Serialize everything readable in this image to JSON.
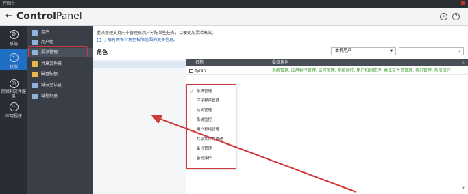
{
  "window": {
    "title": "控制台"
  },
  "header": {
    "logo_part1": "Control",
    "logo_part2": "Panel",
    "icons": [
      "search-icon",
      "help-icon"
    ]
  },
  "rail": {
    "items": [
      {
        "label": "系统",
        "icon": "gear-icon"
      },
      {
        "label": "权限",
        "icon": "user-icon"
      },
      {
        "label": "网络和文件服务",
        "icon": "globe-icon"
      },
      {
        "label": "应用程序",
        "icon": "apps-icon"
      }
    ]
  },
  "subnav": {
    "items": [
      {
        "label": "用户"
      },
      {
        "label": "用户组"
      },
      {
        "label": "委派管理"
      },
      {
        "label": "共享文件夹"
      },
      {
        "label": "磁盘配额"
      },
      {
        "label": "域安全认证"
      },
      {
        "label": "域控制器"
      }
    ]
  },
  "content": {
    "description": "委派管理支持向非管理员用户分配某些任务，以便更加灵活高效。",
    "learn_more": "了解有关每个角色权限范围的更多信息。",
    "role_title": "角色",
    "filter_value": "本机用户",
    "search_placeholder": "",
    "table": {
      "columns": [
        "名称",
        "委派角色"
      ],
      "rows": [
        {
          "name": "tyrsh",
          "roles": "系统管理, 应用程序管理, 访问管理, 系统监控, 用户和组管理, 共享文件夹管理, 备份管理, 备份操作"
        }
      ]
    },
    "dropdown": {
      "items": [
        {
          "label": "系统管理",
          "checked": true
        },
        {
          "label": "应用程序管理",
          "checked": false
        },
        {
          "label": "访问管理",
          "checked": false
        },
        {
          "label": "系统监控",
          "checked": false
        },
        {
          "label": "用户和组管理",
          "checked": false
        },
        {
          "label": "共享文件夹管理",
          "checked": false
        },
        {
          "label": "备份管理",
          "checked": false
        },
        {
          "label": "备份操作",
          "checked": false
        }
      ]
    }
  },
  "colors": {
    "active_rail": "#1f6fc5",
    "annotation_red": "#d23b3b",
    "role_text": "#3a9a2a"
  }
}
